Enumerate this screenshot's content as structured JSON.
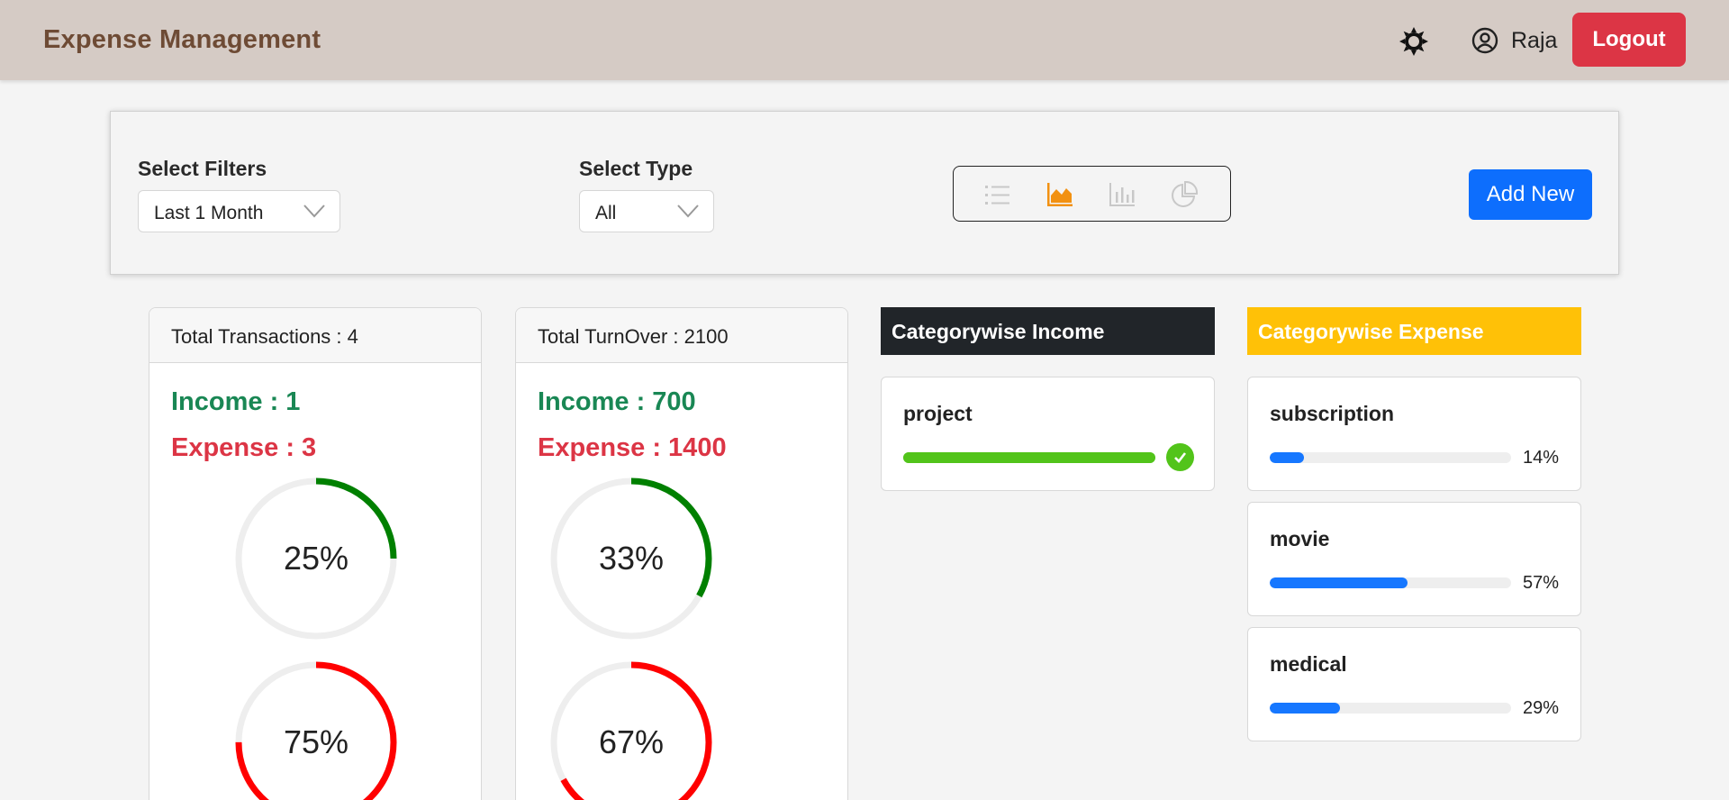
{
  "header": {
    "title": "Expense Management",
    "theme_icon": "sun-icon",
    "user_icon": "user-circle-icon",
    "user_name": "Raja",
    "logout_label": "Logout"
  },
  "filters": {
    "filter_label": "Select Filters",
    "filter_value": "Last 1 Month",
    "type_label": "Select Type",
    "type_value": "All",
    "view_modes": [
      "list-icon",
      "area-chart-icon",
      "bar-chart-icon",
      "pie-chart-icon"
    ],
    "active_view": "area-chart-icon",
    "add_new_label": "Add New"
  },
  "transactions": {
    "title": "Total Transactions : 4",
    "income_text": "Income : 1",
    "expense_text": "Expense : 3",
    "income_pct_text": "25%",
    "expense_pct_text": "75%",
    "income_pct": 25,
    "expense_pct": 75
  },
  "turnover": {
    "title": "Total TurnOver : 2100",
    "income_text": "Income : 700",
    "expense_text": "Expense : 1400",
    "income_pct_text": "33%",
    "expense_pct_text": "67%",
    "income_pct": 33,
    "expense_pct": 67
  },
  "category_income": {
    "title": "Categorywise Income",
    "items": [
      {
        "name": "project",
        "percent": 100,
        "complete": true
      }
    ]
  },
  "category_expense": {
    "title": "Categorywise Expense",
    "items": [
      {
        "name": "subscription",
        "percent": 14,
        "label": "14%"
      },
      {
        "name": "movie",
        "percent": 57,
        "label": "57%"
      },
      {
        "name": "medical",
        "percent": 29,
        "label": "29%"
      }
    ]
  },
  "colors": {
    "header_bg": "#d5cbc5",
    "brand": "#6e4b35",
    "danger": "#dc3545",
    "primary": "#0d6efd",
    "income_ring": "#008000",
    "expense_ring": "#ff0000",
    "ring_track": "#eeeeee",
    "income_bar": "#52c41a",
    "expense_bar": "#1677ff",
    "active_icon": "#f29111",
    "inactive_icon": "#c8c8c8",
    "income_head_bg": "#212529",
    "expense_head_bg": "#ffc107"
  }
}
